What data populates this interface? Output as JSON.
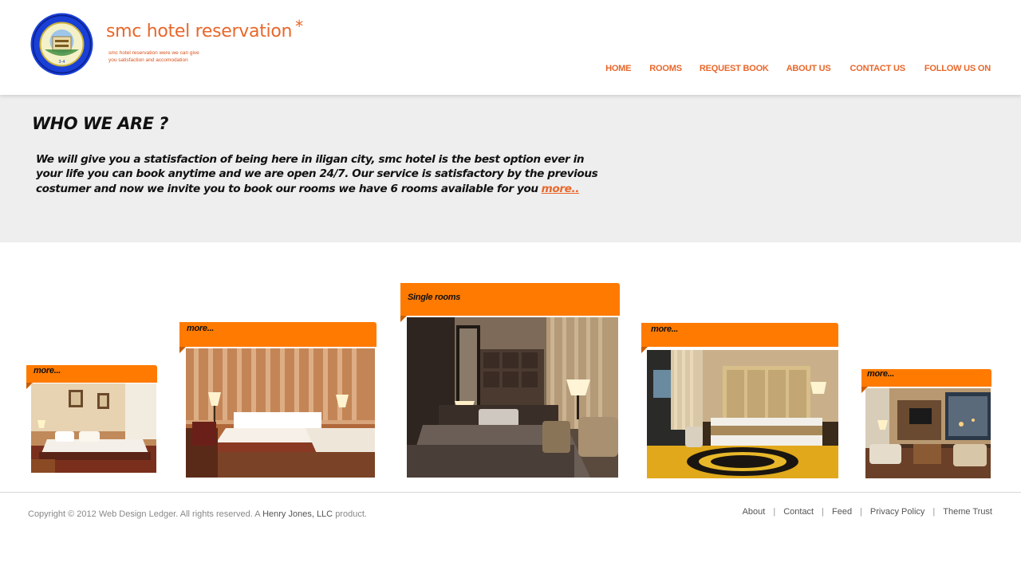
{
  "header": {
    "site_title": "smc hotel reservation",
    "title_star": "*",
    "tagline_1": "smc hotel reservation were we can give",
    "tagline_2": "you  satisfaction and accomodation",
    "logo_icon": "college-seal-icon",
    "nav": [
      "HOME",
      "ROOMS",
      "REQUEST BOOK",
      "ABOUT US",
      "CONTACT US",
      "FOLLOW US  ON"
    ]
  },
  "about": {
    "heading": "WHO WE ARE ?",
    "body": "We will give you a statisfaction of being here in iligan city, smc hotel is the best option ever in your life you can book anytime and we are open 24/7. Our service is satisfactory by the previous costumer and now we invite you to book our rooms we have 6 rooms available for you",
    "more": "more.."
  },
  "gallery": {
    "tab_color": "#ff7a00",
    "items": [
      {
        "label": "more...",
        "image": "hotel-room-photo"
      },
      {
        "label": "more...",
        "image": "hotel-room-photo"
      },
      {
        "label": "Single rooms",
        "image": "hotel-room-photo"
      },
      {
        "label": "more...",
        "image": "hotel-room-photo"
      },
      {
        "label": "more...",
        "image": "hotel-room-photo"
      }
    ]
  },
  "footer": {
    "copyright_prefix": "Copyright © 2012 Web Design Ledger. All rights reserved. A",
    "company": "Henry Jones, LLC",
    "copyright_suffix": "product.",
    "links": [
      "About",
      "Contact",
      "Feed",
      "Privacy Policy",
      "Theme Trust"
    ],
    "separator": "|"
  },
  "colors": {
    "accent": "#e8672a",
    "band_bg": "#eeeeee"
  }
}
